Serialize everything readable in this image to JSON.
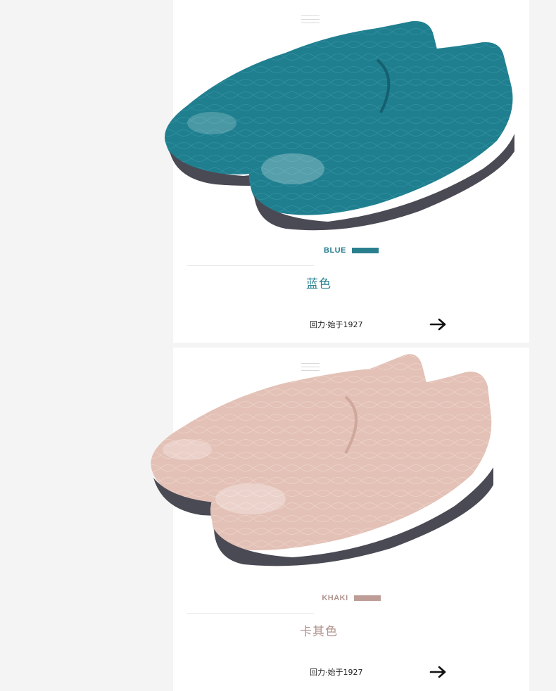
{
  "products": [
    {
      "color_en": "BLUE",
      "color_cn": "蓝色",
      "brand_text": "回力·始于1927",
      "accent": "#267e8e",
      "swatch": "#2a7f8f",
      "shoe_color": "#1f7f8f",
      "shoe_dark": "#156070",
      "sole_color": "#4a4a55",
      "arrow_icon": "arrow-right-icon"
    },
    {
      "color_en": "KHAKI",
      "color_cn": "卡其色",
      "brand_text": "回力·始于1927",
      "accent": "#b2958f",
      "swatch": "#bf9d97",
      "shoe_color": "#e3c1b6",
      "shoe_dark": "#cfa89c",
      "sole_color": "#4a4a55",
      "arrow_icon": "arrow-right-icon"
    }
  ]
}
